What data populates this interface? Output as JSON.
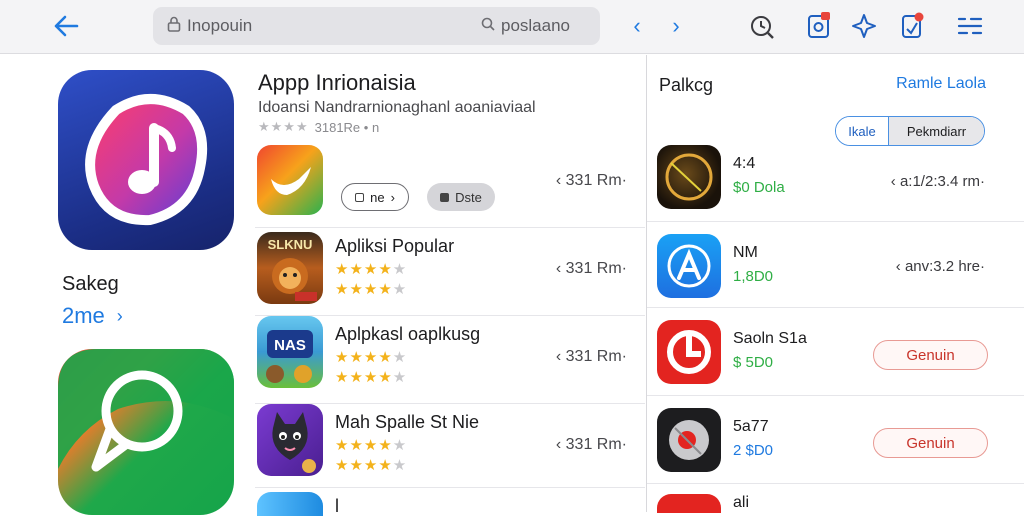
{
  "toolbar": {
    "back_icon": "back-arrow-icon",
    "search_value": "Inopouin",
    "search_right_text": "poslaano",
    "nav_prev": "‹",
    "nav_next": "›"
  },
  "hero": {
    "section_label": "Sakeg",
    "more_link": "2me",
    "more_chevron": "›"
  },
  "featured": {
    "title": "Appp Inrionaisia",
    "subtitle": "Idoansi Nandrarnionaghanl aoaniaviaal",
    "rating_text": "3181Re • n",
    "button_1": "ne",
    "button_1_chevron": "›",
    "button_2": "Dste",
    "size": "‹ 331 Rm·"
  },
  "list": [
    {
      "name": "Apliksi Popular",
      "size": "‹ 331 Rm·",
      "icon_text": "SLKNU"
    },
    {
      "name": "Aplpkasl oaplkusg",
      "size": "‹ 331 Rm·",
      "icon_text": "NAS"
    },
    {
      "name": "Mah Spalle St Nie",
      "size": "‹ 331 Rm·",
      "icon_text": ""
    },
    {
      "name": "l",
      "size": "",
      "icon_text": ""
    }
  ],
  "panel": {
    "title": "Palkcg",
    "link": "Ramle Laola",
    "segment_left": "Ikale",
    "segment_right": "Pekmdiarr",
    "items": [
      {
        "name": "4:4",
        "price": "$0 Dola",
        "meta": "‹ a:1/2:3.4 rm·"
      },
      {
        "name": "NM",
        "price": "1,8D0",
        "meta": "‹ anv:3.2 hre·"
      },
      {
        "name": "Saoln S1a",
        "price": "$ 5D0",
        "button": "Genuin"
      },
      {
        "name": "5a77",
        "price": "2 $D0",
        "button": "Genuin"
      },
      {
        "name": "ali",
        "price": ""
      }
    ]
  },
  "colors": {
    "accent": "#1f7ae0",
    "price_green": "#2fae45",
    "get_red": "#c8342b",
    "star": "#f3b21b"
  }
}
